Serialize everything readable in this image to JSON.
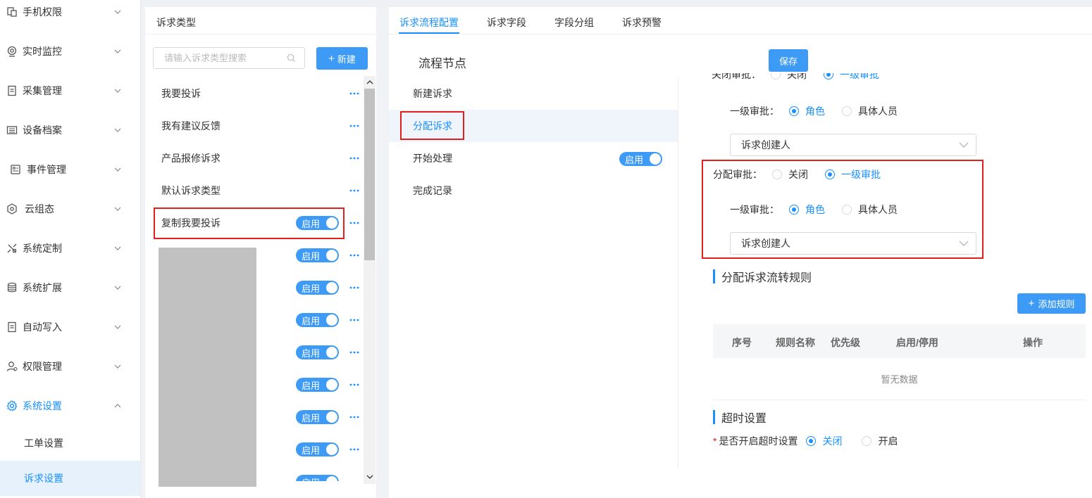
{
  "sidebar": {
    "items": [
      {
        "label": "手机权限",
        "icon": "phone-permission-icon"
      },
      {
        "label": "实时监控",
        "icon": "monitor-icon"
      },
      {
        "label": "采集管理",
        "icon": "document-icon"
      },
      {
        "label": "设备档案",
        "icon": "archive-icon"
      },
      {
        "label": "事件管理",
        "icon": "event-icon"
      },
      {
        "label": "云组态",
        "icon": "hexagon-icon"
      },
      {
        "label": "系统定制",
        "icon": "customize-icon"
      },
      {
        "label": "系统扩展",
        "icon": "database-icon"
      },
      {
        "label": "自动写入",
        "icon": "write-icon"
      },
      {
        "label": "权限管理",
        "icon": "user-permission-icon"
      },
      {
        "label": "系统设置",
        "icon": "gear-icon"
      }
    ],
    "sub_items": [
      {
        "label": "工单设置"
      },
      {
        "label": "诉求设置"
      }
    ]
  },
  "type_panel": {
    "title": "诉求类型",
    "search_placeholder": "请输入诉求类型搜索",
    "new_button": "新建",
    "items": [
      {
        "label": "我要投诉"
      },
      {
        "label": "我有建议反馈"
      },
      {
        "label": "产品报修诉求"
      },
      {
        "label": "默认诉求类型"
      },
      {
        "label": "复制我要投诉"
      }
    ],
    "toggle_label": "启用"
  },
  "config": {
    "tabs": [
      {
        "label": "诉求流程配置"
      },
      {
        "label": "诉求字段"
      },
      {
        "label": "字段分组"
      },
      {
        "label": "诉求预警"
      }
    ],
    "flow_title": "流程节点",
    "save_button": "保存",
    "nodes": [
      {
        "label": "新建诉求"
      },
      {
        "label": "分配诉求"
      },
      {
        "label": "开始处理"
      },
      {
        "label": "完成记录"
      }
    ],
    "node_toggle": "启用",
    "cut_row": {
      "label": "关闭审批：",
      "opt1": "关闭",
      "opt2": "一级审批"
    },
    "level1_label": "一级审批：",
    "opt_role": "角色",
    "opt_person": "具体人员",
    "select_value": "诉求创建人",
    "assign_label": "分配审批：",
    "opt_close": "关闭",
    "opt_level1": "一级审批",
    "rules_title": "分配诉求流转规则",
    "add_rule": "添加规则",
    "table_headers": [
      "序号",
      "规则名称",
      "优先级",
      "启用/停用",
      "操作"
    ],
    "empty_text": "暂无数据",
    "timeout_title": "超时设置",
    "timeout_label": "是否开启超时设置",
    "timeout_off": "关闭",
    "timeout_on": "开启"
  },
  "colors": {
    "accent": "#1890ff",
    "button": "#3d9bf5",
    "highlight_box": "#e0201c"
  }
}
